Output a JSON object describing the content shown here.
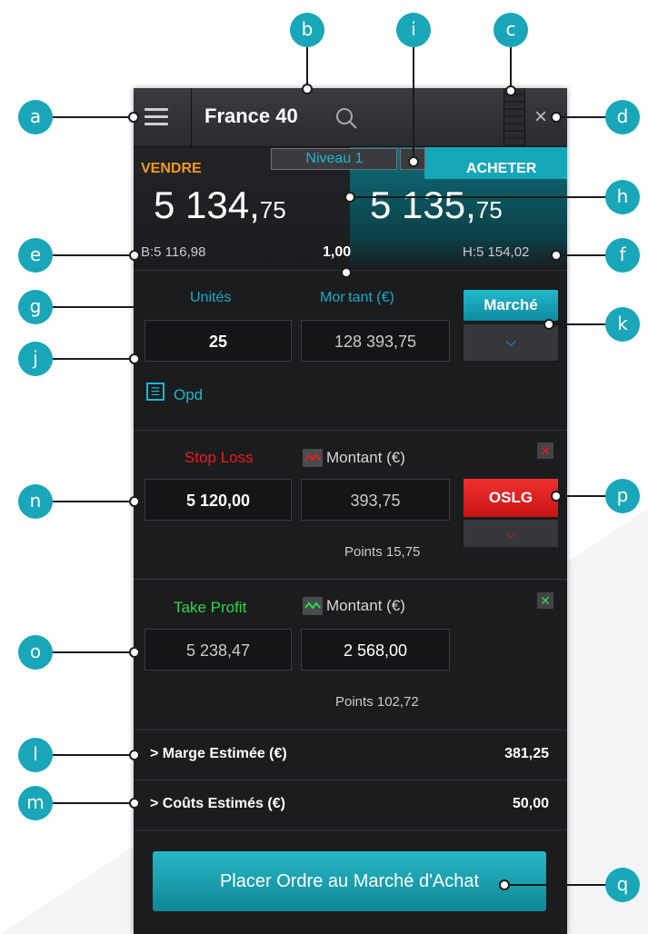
{
  "header": {
    "market_name": "France 40",
    "close_glyph": "×"
  },
  "quote": {
    "level": "Niveau 1",
    "sell_label": "VENDRE",
    "buy_label": "ACHETER",
    "sell_price_main": "5 134,",
    "sell_price_small": "75",
    "buy_price_main": "5 135,",
    "buy_price_small": "75",
    "low": "B:5 116,98",
    "high": "H:5 154,02",
    "spread": "1,00"
  },
  "order": {
    "units_label": "Unités",
    "amount_label": "Montant (€)",
    "units_value": "25",
    "amount_value": "128 393,75",
    "order_type": "Marché",
    "opd_label": "Opd"
  },
  "stop_loss": {
    "label": "Stop Loss",
    "amount_label": "Montant (€)",
    "level_value": "5 120,00",
    "amount_value": "393,75",
    "type": "OSLG",
    "points": "Points 15,75",
    "remove_glyph": "✕"
  },
  "take_profit": {
    "label": "Take Profit",
    "amount_label": "Montant (€)",
    "level_value": "5 238,47",
    "amount_value": "2 568,00",
    "points": "Points 102,72",
    "remove_glyph": "✕"
  },
  "summary": {
    "margin_label": "Marge Estimée (€)",
    "margin_value": "381,25",
    "costs_label": "Coûts Estimés (€)",
    "costs_value": "50,00",
    "expand_glyph": ">"
  },
  "place_order_label": "Placer Ordre au Marché d'Achat",
  "callouts": {
    "a": "a",
    "b": "b",
    "c": "c",
    "d": "d",
    "e": "e",
    "f": "f",
    "g": "g",
    "h": "h",
    "i": "i",
    "j": "j",
    "k": "k",
    "l": "l",
    "m": "m",
    "n": "n",
    "o": "o",
    "p": "p",
    "q": "q"
  },
  "colors": {
    "accent": "#19a6b8",
    "sell": "#f39a1c",
    "stop_loss": "#ee1b1b",
    "take_profit": "#2cd84a",
    "panel": "#1b1c1e"
  }
}
